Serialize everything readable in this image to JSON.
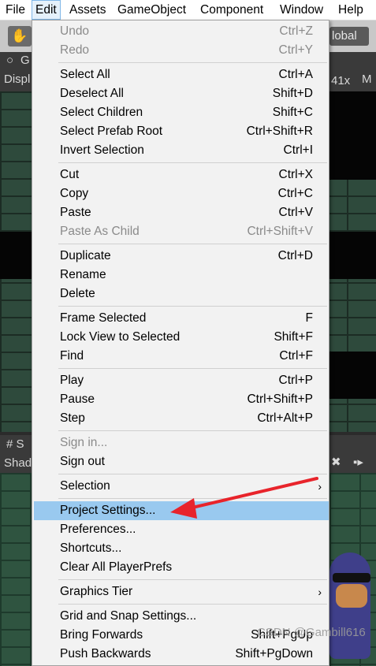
{
  "menubar": {
    "items": [
      "File",
      "Edit",
      "Assets",
      "GameObject",
      "Component",
      "Window",
      "Help"
    ],
    "active": "Edit"
  },
  "background": {
    "global_button": "lobal",
    "game_tab": "G",
    "display_label": "Displ",
    "zoom_fragment": "41x",
    "max_fragment": "M",
    "scene_tab": "# S",
    "shading_label": "Shad",
    "hand_icon": "hand-tool-icon"
  },
  "edit_menu": {
    "groups": [
      [
        {
          "label": "Undo",
          "shortcut": "Ctrl+Z",
          "disabled": true
        },
        {
          "label": "Redo",
          "shortcut": "Ctrl+Y",
          "disabled": true
        }
      ],
      [
        {
          "label": "Select All",
          "shortcut": "Ctrl+A"
        },
        {
          "label": "Deselect All",
          "shortcut": "Shift+D"
        },
        {
          "label": "Select Children",
          "shortcut": "Shift+C"
        },
        {
          "label": "Select Prefab Root",
          "shortcut": "Ctrl+Shift+R"
        },
        {
          "label": "Invert Selection",
          "shortcut": "Ctrl+I"
        }
      ],
      [
        {
          "label": "Cut",
          "shortcut": "Ctrl+X"
        },
        {
          "label": "Copy",
          "shortcut": "Ctrl+C"
        },
        {
          "label": "Paste",
          "shortcut": "Ctrl+V"
        },
        {
          "label": "Paste As Child",
          "shortcut": "Ctrl+Shift+V",
          "disabled": true
        }
      ],
      [
        {
          "label": "Duplicate",
          "shortcut": "Ctrl+D"
        },
        {
          "label": "Rename",
          "shortcut": ""
        },
        {
          "label": "Delete",
          "shortcut": ""
        }
      ],
      [
        {
          "label": "Frame Selected",
          "shortcut": "F"
        },
        {
          "label": "Lock View to Selected",
          "shortcut": "Shift+F"
        },
        {
          "label": "Find",
          "shortcut": "Ctrl+F"
        }
      ],
      [
        {
          "label": "Play",
          "shortcut": "Ctrl+P"
        },
        {
          "label": "Pause",
          "shortcut": "Ctrl+Shift+P"
        },
        {
          "label": "Step",
          "shortcut": "Ctrl+Alt+P"
        }
      ],
      [
        {
          "label": "Sign in...",
          "shortcut": "",
          "disabled": true
        },
        {
          "label": "Sign out",
          "shortcut": ""
        }
      ],
      [
        {
          "label": "Selection",
          "shortcut": "",
          "submenu": true
        }
      ],
      [
        {
          "label": "Project Settings...",
          "shortcut": "",
          "highlighted": true
        },
        {
          "label": "Preferences...",
          "shortcut": ""
        },
        {
          "label": "Shortcuts...",
          "shortcut": ""
        },
        {
          "label": "Clear All PlayerPrefs",
          "shortcut": ""
        }
      ],
      [
        {
          "label": "Graphics Tier",
          "shortcut": "",
          "submenu": true
        }
      ],
      [
        {
          "label": "Grid and Snap Settings...",
          "shortcut": ""
        },
        {
          "label": "Bring Forwards",
          "shortcut": "Shift+PgUp"
        },
        {
          "label": "Push Backwards",
          "shortcut": "Shift+PgDown"
        }
      ]
    ],
    "submenu_glyph": "›"
  },
  "watermark": "CSDN @Gambill616",
  "annotation": {
    "color": "#e8242b",
    "target": "Project Settings..."
  }
}
